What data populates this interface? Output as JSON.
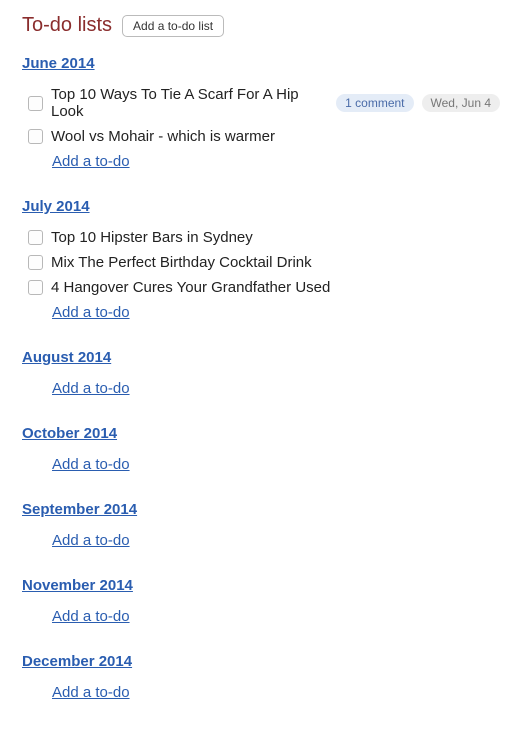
{
  "header": {
    "title": "To-do lists",
    "add_list_button": "Add a to-do list"
  },
  "add_todo_label": "Add a to-do",
  "lists": [
    {
      "title": "June 2014",
      "items": [
        {
          "text": "Top 10 Ways To Tie A Scarf For A Hip Look",
          "comments": "1 comment",
          "date": "Wed, Jun 4"
        },
        {
          "text": "Wool vs Mohair - which is warmer"
        }
      ]
    },
    {
      "title": "July 2014",
      "items": [
        {
          "text": "Top 10 Hipster Bars in Sydney"
        },
        {
          "text": "Mix The Perfect Birthday Cocktail Drink"
        },
        {
          "text": "4 Hangover Cures Your Grandfather Used"
        }
      ]
    },
    {
      "title": "August 2014",
      "items": []
    },
    {
      "title": "October 2014",
      "items": []
    },
    {
      "title": "September 2014",
      "items": []
    },
    {
      "title": "November 2014",
      "items": []
    },
    {
      "title": "December 2014",
      "items": []
    }
  ]
}
